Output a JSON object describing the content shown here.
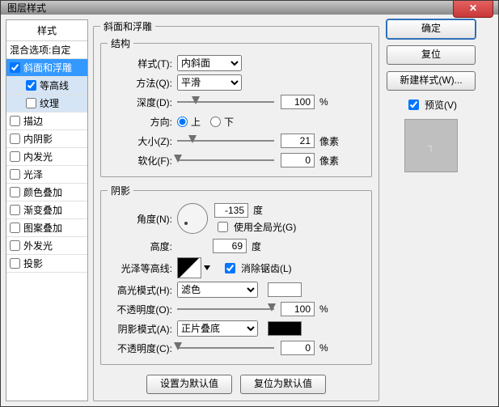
{
  "window": {
    "title": "图层样式"
  },
  "left": {
    "header": "样式",
    "blend": "混合选项:自定",
    "items": [
      {
        "label": "斜面和浮雕",
        "checked": true,
        "selected": "blue"
      },
      {
        "label": "等高线",
        "checked": true,
        "selected": "grey",
        "indent": true
      },
      {
        "label": "纹理",
        "checked": false,
        "selected": "grey",
        "indent": true
      },
      {
        "label": "描边",
        "checked": false
      },
      {
        "label": "内阴影",
        "checked": false
      },
      {
        "label": "内发光",
        "checked": false
      },
      {
        "label": "光泽",
        "checked": false
      },
      {
        "label": "颜色叠加",
        "checked": false
      },
      {
        "label": "渐变叠加",
        "checked": false
      },
      {
        "label": "图案叠加",
        "checked": false
      },
      {
        "label": "外发光",
        "checked": false
      },
      {
        "label": "投影",
        "checked": false
      }
    ]
  },
  "panel": {
    "title": "斜面和浮雕",
    "structure": {
      "legend": "结构",
      "style_lbl": "样式(T):",
      "style_val": "内斜面",
      "tech_lbl": "方法(Q):",
      "tech_val": "平滑",
      "depth_lbl": "深度(D):",
      "depth_val": "100",
      "depth_unit": "%",
      "dir_lbl": "方向:",
      "dir_up": "上",
      "dir_down": "下",
      "size_lbl": "大小(Z):",
      "size_val": "21",
      "size_unit": "像素",
      "soft_lbl": "软化(F):",
      "soft_val": "0",
      "soft_unit": "像素"
    },
    "shading": {
      "legend": "阴影",
      "angle_lbl": "角度(N):",
      "angle_val": "-135",
      "angle_unit": "度",
      "global_lbl": "使用全局光(G)",
      "alt_lbl": "高度:",
      "alt_val": "69",
      "alt_unit": "度",
      "gloss_lbl": "光泽等高线:",
      "antialias_lbl": "消除锯齿(L)",
      "hilite_lbl": "高光模式(H):",
      "hilite_val": "滤色",
      "hilite_op_lbl": "不透明度(O):",
      "hilite_op_val": "100",
      "hilite_op_unit": "%",
      "shadow_lbl": "阴影模式(A):",
      "shadow_val": "正片叠底",
      "shadow_op_lbl": "不透明度(C):",
      "shadow_op_val": "0",
      "shadow_op_unit": "%"
    },
    "reset_btn": "设置为默认值",
    "restore_btn": "复位为默认值"
  },
  "right": {
    "ok": "确定",
    "cancel": "复位",
    "newstyle": "新建样式(W)...",
    "preview": "预览(V)"
  },
  "colors": {
    "hilite_swatch": "#FFFFFF",
    "shadow_swatch": "#000000"
  }
}
